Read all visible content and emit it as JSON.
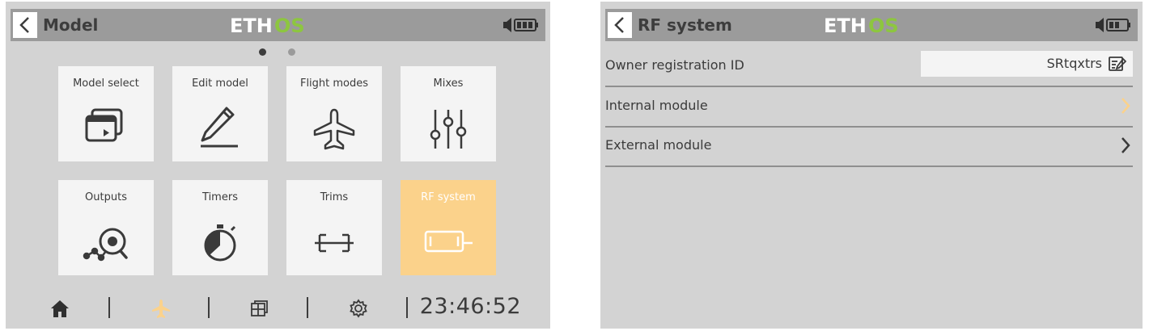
{
  "left_screen": {
    "header": {
      "title": "Model",
      "logo_text_1": "ETH",
      "logo_text_2": "OS"
    },
    "page_indicator": {
      "current": 1,
      "total": 2
    },
    "tiles": [
      {
        "label": "Model select",
        "icon": "model-select-icon",
        "active": false
      },
      {
        "label": "Edit model",
        "icon": "pencil-icon",
        "active": false
      },
      {
        "label": "Flight modes",
        "icon": "airplane-icon",
        "active": false
      },
      {
        "label": "Mixes",
        "icon": "sliders-icon",
        "active": false
      },
      {
        "label": "Outputs",
        "icon": "outputs-icon",
        "active": false
      },
      {
        "label": "Timers",
        "icon": "stopwatch-icon",
        "active": false
      },
      {
        "label": "Trims",
        "icon": "trims-icon",
        "active": false
      },
      {
        "label": "RF system",
        "icon": "rf-module-icon",
        "active": true
      }
    ],
    "bottom_bar": {
      "items": [
        "home-icon",
        "airplane-icon",
        "layout-icon",
        "gear-icon"
      ],
      "active_item": "airplane-icon",
      "clock": "23:46:52"
    }
  },
  "right_screen": {
    "header": {
      "title": "RF system",
      "logo_text_1": "ETH",
      "logo_text_2": "OS"
    },
    "rows": {
      "owner_label": "Owner registration ID",
      "owner_value": "SRtqxtrs",
      "internal_label": "Internal module",
      "external_label": "External module"
    }
  },
  "colors": {
    "screen_bg": "#d3d3d3",
    "header_bg": "#9b9b9b",
    "tile_bg": "#f4f4f4",
    "accent_orange": "#fbd28b",
    "logo_green": "#8dc63f",
    "text": "#3b3b3b"
  }
}
